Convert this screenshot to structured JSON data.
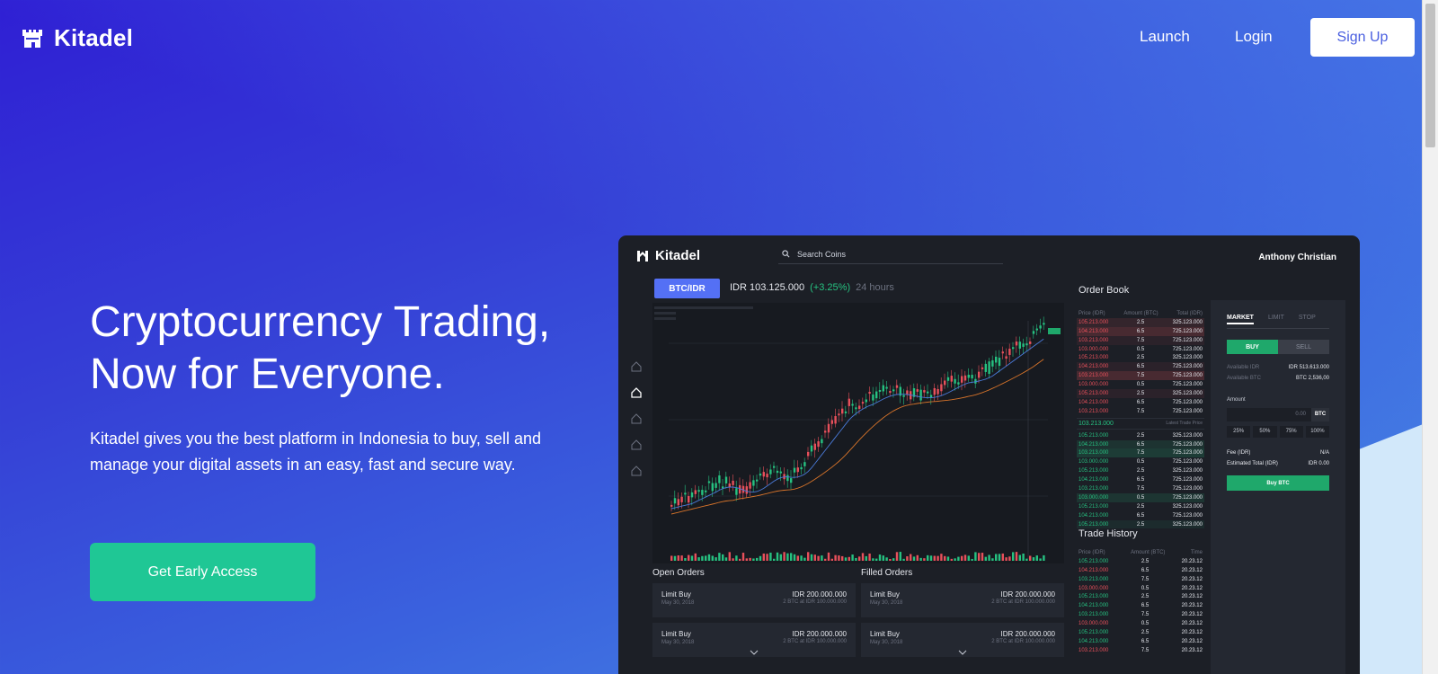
{
  "brand": {
    "name": "Kitadel"
  },
  "nav": {
    "launch": "Launch",
    "login": "Login",
    "signup": "Sign Up"
  },
  "hero": {
    "title_line1": "Cryptocurrency Trading,",
    "title_line2": "Now for Everyone.",
    "description": "Kitadel gives you the best platform in Indonesia to buy, sell and manage your digital assets in an easy, fast and secure way.",
    "cta": "Get Early Access"
  },
  "colors": {
    "cta": "#1fc795",
    "accent_buy": "#1fa86b",
    "pair_button": "#5470f5",
    "ask": "#e8505b",
    "bid": "#26c281"
  },
  "dashboard": {
    "brand": "Kitadel",
    "search_placeholder": "Search Coins",
    "user": "Anthony Christian",
    "pair": "BTC/IDR",
    "price": "IDR 103.125.000",
    "change": "(+3.25%)",
    "period": "24 hours",
    "order_book": {
      "title": "Order Book",
      "headers": [
        "Price (IDR)",
        "Amount (BTC)",
        "Total (IDR)"
      ],
      "asks": [
        [
          "105.213.000",
          "2.5",
          "325.123.000"
        ],
        [
          "104.213.000",
          "6.5",
          "725.123.000"
        ],
        [
          "103.213.000",
          "7.5",
          "725.123.000"
        ],
        [
          "103.000.000",
          "0.5",
          "725.123.000"
        ],
        [
          "105.213.000",
          "2.5",
          "325.123.000"
        ],
        [
          "104.213.000",
          "6.5",
          "725.123.000"
        ],
        [
          "103.213.000",
          "7.5",
          "725.123.000"
        ],
        [
          "103.000.000",
          "0.5",
          "725.123.000"
        ],
        [
          "105.213.000",
          "2.5",
          "325.123.000"
        ],
        [
          "104.213.000",
          "6.5",
          "725.123.000"
        ],
        [
          "103.213.000",
          "7.5",
          "725.123.000"
        ]
      ],
      "last_price": "103.213.000",
      "last_label": "Latest Trade Price",
      "bids": [
        [
          "105.213.000",
          "2.5",
          "325.123.000"
        ],
        [
          "104.213.000",
          "6.5",
          "725.123.000"
        ],
        [
          "103.213.000",
          "7.5",
          "725.123.000"
        ],
        [
          "103.000.000",
          "0.5",
          "725.123.000"
        ],
        [
          "105.213.000",
          "2.5",
          "325.123.000"
        ],
        [
          "104.213.000",
          "6.5",
          "725.123.000"
        ],
        [
          "103.213.000",
          "7.5",
          "725.123.000"
        ],
        [
          "103.000.000",
          "0.5",
          "725.123.000"
        ],
        [
          "105.213.000",
          "2.5",
          "325.123.000"
        ],
        [
          "104.213.000",
          "6.5",
          "725.123.000"
        ],
        [
          "105.213.000",
          "2.5",
          "325.123.000"
        ]
      ]
    },
    "trade_history": {
      "title": "Trade History",
      "headers": [
        "Price (IDR)",
        "Amount (BTC)",
        "Time"
      ],
      "rows": [
        [
          "105.213.000",
          "2.5",
          "20.23.12",
          "green"
        ],
        [
          "104.213.000",
          "6.5",
          "20.23.12",
          "red"
        ],
        [
          "103.213.000",
          "7.5",
          "20.23.12",
          "green"
        ],
        [
          "103.000.000",
          "0.5",
          "20.23.12",
          "red"
        ],
        [
          "105.213.000",
          "2.5",
          "20.23.12",
          "green"
        ],
        [
          "104.213.000",
          "6.5",
          "20.23.12",
          "green"
        ],
        [
          "103.213.000",
          "7.5",
          "20.23.12",
          "green"
        ],
        [
          "103.000.000",
          "0.5",
          "20.23.12",
          "red"
        ],
        [
          "105.213.000",
          "2.5",
          "20.23.12",
          "green"
        ],
        [
          "104.213.000",
          "6.5",
          "20.23.12",
          "green"
        ],
        [
          "103.213.000",
          "7.5",
          "20.23.12",
          "red"
        ]
      ]
    },
    "trade": {
      "tabs": [
        "MARKET",
        "LIMIT",
        "STOP"
      ],
      "buy": "BUY",
      "sell": "SELL",
      "available_idr_label": "Available IDR",
      "available_idr": "IDR 513.613.000",
      "available_btc_label": "Available BTC",
      "available_btc": "BTC 2,536,00",
      "amount_label": "Amount",
      "amount_value": "0.00",
      "amount_unit": "BTC",
      "percents": [
        "25%",
        "50%",
        "75%",
        "100%"
      ],
      "fee_label": "Fee (IDR)",
      "fee_value": "N/A",
      "est_label": "Estimated Total (IDR)",
      "est_value": "IDR 0.00",
      "buy_button": "Buy BTC"
    },
    "open_orders": {
      "title": "Open Orders",
      "items": [
        {
          "type": "Limit Buy",
          "date": "May 30, 2018",
          "amount": "IDR 200.000.000",
          "detail": "2 BTC at IDR 100.000.000"
        },
        {
          "type": "Limit Buy",
          "date": "May 30, 2018",
          "amount": "IDR 200.000.000",
          "detail": "2 BTC at IDR 100.000.000"
        }
      ]
    },
    "filled_orders": {
      "title": "Filled Orders",
      "items": [
        {
          "type": "Limit Buy",
          "date": "May 30, 2018",
          "amount": "IDR 200.000.000",
          "detail": "2 BTC at IDR 100.000.000"
        },
        {
          "type": "Limit Buy",
          "date": "May 30, 2018",
          "amount": "IDR 200.000.000",
          "detail": "2 BTC at IDR 100.000.000"
        }
      ]
    }
  }
}
